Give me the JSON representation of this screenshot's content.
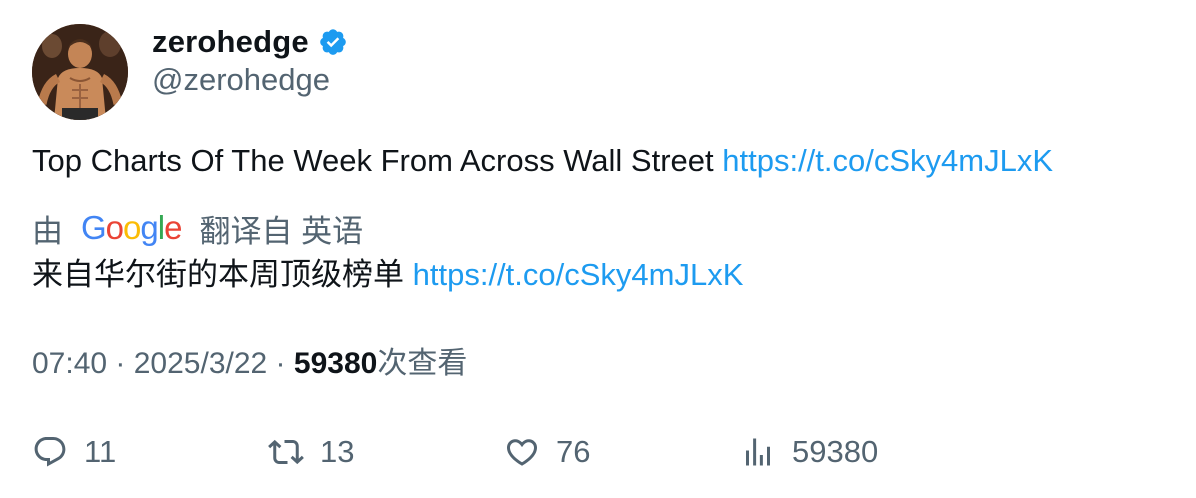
{
  "author": {
    "display_name": "zerohedge",
    "handle": "@zerohedge",
    "verified": true,
    "avatar_icon": "avatar-photo"
  },
  "tweet": {
    "text": "Top Charts Of The Week From Across Wall Street ",
    "link": "https://t.co/cSky4mJLxK"
  },
  "translation": {
    "by_label": "由",
    "provider_letters": [
      "G",
      "o",
      "o",
      "g",
      "l",
      "e"
    ],
    "provider_colors": [
      "#4285f4",
      "#ea4335",
      "#fbbc05",
      "#4285f4",
      "#34a853",
      "#ea4335"
    ],
    "from_label": "翻译自 英语",
    "text": "来自华尔街的本周顶级榜单 ",
    "link": "https://t.co/cSky4mJLxK"
  },
  "meta": {
    "time": "07:40",
    "separator1": " · ",
    "date": "2025/3/22",
    "separator2": " · ",
    "views": "59380",
    "views_label": "次查看"
  },
  "actions": {
    "replies": "11",
    "retweets": "13",
    "likes": "76",
    "views": "59380"
  },
  "colors": {
    "link": "#1d9bf0",
    "verified": "#1d9bf0",
    "secondary_text": "#536471",
    "primary_text": "#0f1419"
  }
}
